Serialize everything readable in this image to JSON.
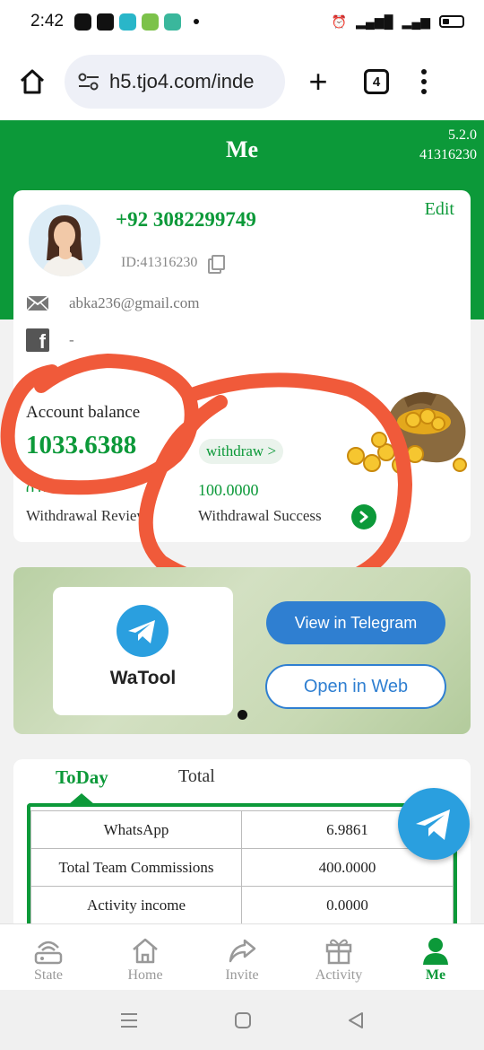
{
  "status_bar": {
    "time": "2:42"
  },
  "browser": {
    "url": "h5.tjo4.com/inde",
    "tab_count": "4"
  },
  "header": {
    "title": "Me",
    "version": "5.2.0",
    "uid": "41316230"
  },
  "profile": {
    "phone": "+92 3082299749",
    "edit_label": "Edit",
    "id_text": "ID:41316230",
    "email": "abka236@gmail.com",
    "facebook": "-"
  },
  "balance": {
    "label": "Account balance",
    "value": "1033.6388",
    "withdraw_label": "withdraw >",
    "review_value": "0.0000",
    "review_label": "Withdrawal Review",
    "success_value": "100.0000",
    "success_label": "Withdrawal Success"
  },
  "banner": {
    "app_name": "WaTool",
    "telegram_button": "View in Telegram",
    "web_button": "Open in Web"
  },
  "stats": {
    "tabs": [
      "ToDay",
      "Total"
    ],
    "rows": [
      {
        "label": "WhatsApp",
        "value": "6.9861"
      },
      {
        "label": "Total Team Commissions",
        "value": "400.0000"
      },
      {
        "label": "Activity income",
        "value": "0.0000"
      }
    ]
  },
  "bottom_nav": {
    "items": [
      {
        "label": "State",
        "icon": "router-icon"
      },
      {
        "label": "Home",
        "icon": "home-icon"
      },
      {
        "label": "Invite",
        "icon": "share-icon"
      },
      {
        "label": "Activity",
        "icon": "gift-icon"
      },
      {
        "label": "Me",
        "icon": "user-icon"
      }
    ],
    "active": "Me"
  },
  "colors": {
    "primary": "#0c9939",
    "telegram": "#2a9fdf",
    "annotation": "#f05a3a"
  }
}
